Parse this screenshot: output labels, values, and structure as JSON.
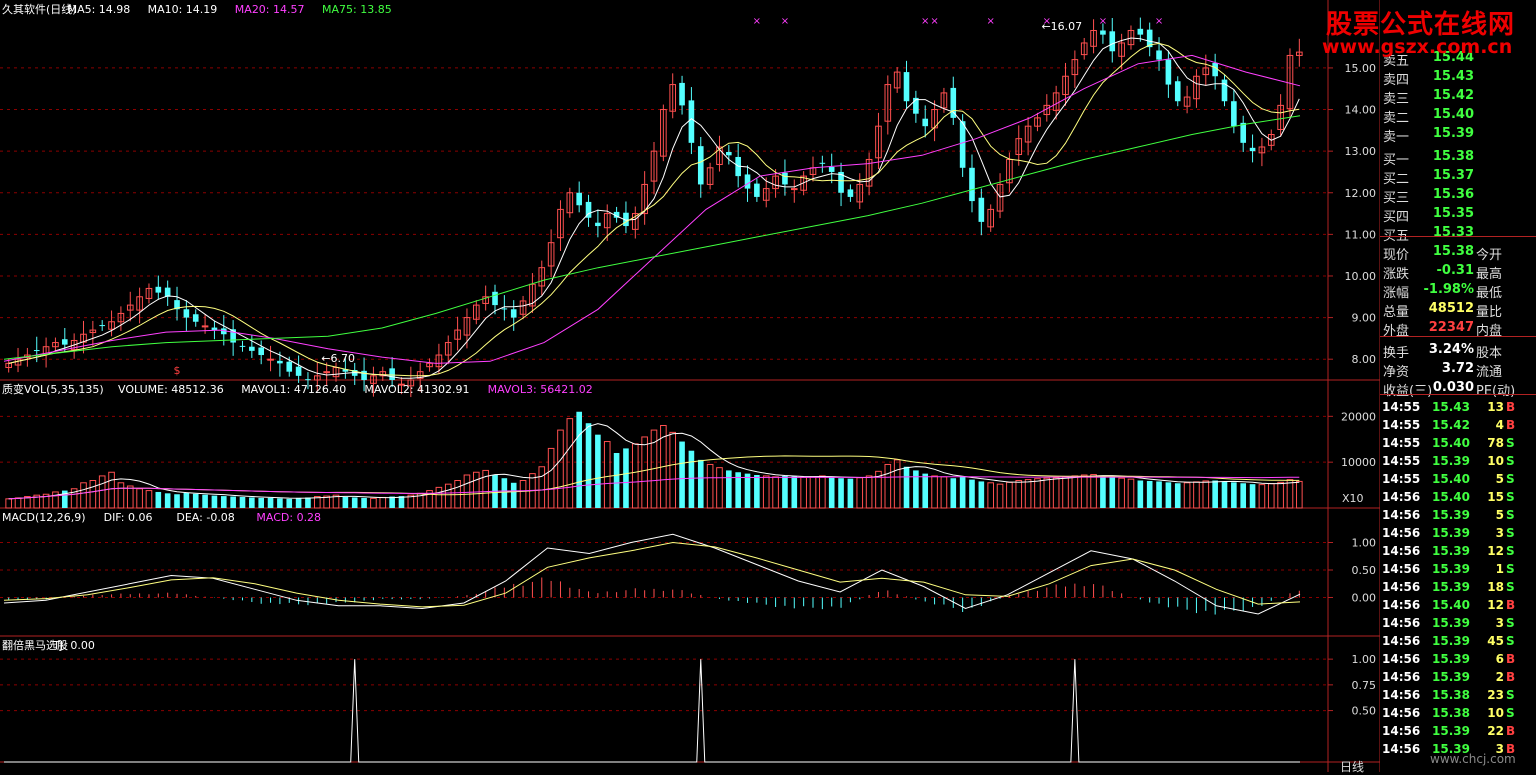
{
  "colors": {
    "up": "#ff5050",
    "down": "#54ffff",
    "ma5": "#ffffff",
    "ma10": "#ffff80",
    "ma20": "#ff40ff",
    "ma75": "#40ff40",
    "grid": "#8b0000",
    "axis": "#b22222"
  },
  "logo": {
    "line1": "股票公式在线网",
    "line2": "www.gszx.com.cn"
  },
  "watermark": "www.chcj.com",
  "bottom_label": "日线",
  "chart_data": [
    {
      "type": "candlestick",
      "panel": "price",
      "legend": [
        {
          "text": "久其软件(日线)",
          "color": "#ffffff"
        },
        {
          "text": "MA5: 14.98",
          "color": "#ffffff"
        },
        {
          "text": "MA10: 14.19",
          "color": "#ffffff"
        },
        {
          "text": "MA20: 14.57",
          "color": "#ff40ff"
        },
        {
          "text": "MA75: 13.85",
          "color": "#40ff40"
        }
      ],
      "ylim": [
        7.5,
        16.2
      ],
      "yticks": [
        "8.00",
        "9.00",
        "10.00",
        "11.00",
        "12.00",
        "13.00",
        "14.00",
        "15.00"
      ],
      "ytick_values": [
        8,
        9,
        10,
        11,
        12,
        13,
        14,
        15
      ],
      "annotations": [
        {
          "text": "16.07",
          "x_index": 110,
          "y": 16.07
        },
        {
          "text": "6.70",
          "x_index": 33,
          "y": 6.7
        },
        {
          "text": "$",
          "x_index": 18,
          "y": 7.2
        }
      ],
      "closes": [
        7.9,
        8.0,
        8.1,
        8.2,
        8.3,
        8.4,
        8.35,
        8.45,
        8.6,
        8.7,
        8.8,
        8.9,
        9.1,
        9.3,
        9.5,
        9.7,
        9.6,
        9.5,
        9.2,
        9.0,
        8.9,
        8.8,
        8.7,
        8.6,
        8.4,
        8.3,
        8.2,
        8.1,
        8.0,
        7.9,
        7.7,
        7.6,
        7.5,
        7.6,
        7.7,
        7.8,
        7.7,
        7.6,
        7.5,
        7.6,
        7.7,
        7.5,
        7.4,
        7.5,
        7.7,
        7.9,
        8.1,
        8.4,
        8.7,
        9.0,
        9.3,
        9.5,
        9.3,
        9.2,
        9.0,
        9.4,
        9.8,
        10.2,
        10.8,
        11.6,
        12.0,
        11.7,
        11.4,
        11.2,
        11.5,
        11.4,
        11.2,
        11.5,
        12.2,
        13.0,
        14.0,
        14.6,
        14.1,
        13.2,
        12.2,
        12.6,
        13.1,
        12.9,
        12.4,
        12.1,
        11.9,
        12.1,
        12.4,
        12.2,
        12.1,
        12.4,
        12.6,
        12.7,
        12.5,
        12.0,
        11.9,
        12.2,
        12.8,
        13.6,
        14.6,
        14.9,
        14.2,
        13.9,
        13.6,
        14.0,
        14.4,
        13.8,
        12.6,
        11.8,
        11.3,
        11.6,
        12.2,
        12.8,
        13.3,
        13.6,
        13.8,
        14.1,
        14.4,
        14.8,
        15.2,
        15.6,
        15.9,
        15.8,
        15.4,
        15.6,
        15.9,
        15.8,
        15.5,
        15.2,
        14.6,
        14.2,
        14.3,
        14.8,
        15.0,
        14.8,
        14.2,
        13.6,
        13.2,
        13.0,
        13.1,
        13.4,
        14.1,
        15.3,
        15.38
      ],
      "ma75_points": [
        8.0,
        8.15,
        8.3,
        8.4,
        8.45,
        8.5,
        8.55,
        8.75,
        9.1,
        9.5,
        9.9,
        10.2,
        10.45,
        10.7,
        10.95,
        11.2,
        11.45,
        11.75,
        12.1,
        12.45,
        12.8,
        13.1,
        13.4,
        13.65,
        13.85
      ],
      "ma20_points": [
        7.95,
        8.2,
        8.45,
        8.65,
        8.7,
        8.5,
        8.25,
        8.05,
        7.9,
        7.95,
        8.4,
        9.2,
        10.4,
        11.6,
        12.4,
        12.6,
        12.7,
        12.9,
        13.3,
        13.8,
        14.5,
        15.1,
        15.3,
        14.9,
        14.57
      ]
    },
    {
      "type": "bar",
      "panel": "volume",
      "legend": [
        {
          "text": "质变VOL(5,35,135)",
          "color": "#ffffff"
        },
        {
          "text": "VOLUME: 48512.36",
          "color": "#ffffff"
        },
        {
          "text": "MAVOL1: 47126.40",
          "color": "#ffffff"
        },
        {
          "text": "MAVOL2: 41302.91",
          "color": "#ffffff"
        },
        {
          "text": "MAVOL3: 56421.02",
          "color": "#ff40ff"
        }
      ],
      "yticks": [
        "20000",
        "10000"
      ],
      "ytick_values": [
        20000,
        10000
      ],
      "ylim": [
        0,
        24000
      ],
      "unit": "X10",
      "values": [
        2000,
        2200,
        2500,
        2800,
        3000,
        3500,
        3800,
        4200,
        5500,
        6000,
        7000,
        7800,
        5500,
        4800,
        4200,
        3800,
        3500,
        3200,
        3000,
        3300,
        3100,
        2900,
        2700,
        2600,
        2500,
        2400,
        2300,
        2200,
        2200,
        2100,
        2000,
        2200,
        2300,
        2500,
        2600,
        2800,
        2400,
        2300,
        2200,
        2100,
        2300,
        2500,
        2600,
        2800,
        3200,
        3800,
        4500,
        5200,
        6000,
        7200,
        7800,
        8200,
        7200,
        6500,
        5500,
        6000,
        7500,
        9000,
        13000,
        17000,
        19500,
        21000,
        18500,
        16000,
        14500,
        12000,
        13000,
        14000,
        15500,
        17000,
        18000,
        16500,
        14500,
        12500,
        10500,
        9500,
        8800,
        8200,
        7800,
        7500,
        7200,
        7000,
        6800,
        7000,
        6900,
        6700,
        6800,
        7000,
        6800,
        6500,
        6400,
        6600,
        7000,
        8000,
        9500,
        10500,
        9000,
        8200,
        7500,
        7000,
        6800,
        6500,
        6800,
        6200,
        5800,
        5500,
        5200,
        5600,
        6000,
        6200,
        6400,
        6500,
        6600,
        6800,
        7000,
        7200,
        7300,
        7100,
        6800,
        6500,
        6300,
        6000,
        5900,
        5800,
        5600,
        5400,
        5500,
        5700,
        5900,
        6000,
        5800,
        5600,
        5400,
        5200,
        5100,
        5300,
        5600,
        6200,
        5800
      ]
    },
    {
      "type": "line",
      "panel": "macd",
      "legend": [
        {
          "text": "MACD(12,26,9)",
          "color": "#ffffff"
        },
        {
          "text": "DIF: 0.06",
          "color": "#ffffff"
        },
        {
          "text": "DEA: -0.08",
          "color": "#ffffff"
        },
        {
          "text": "MACD: 0.28",
          "color": "#ff40ff"
        }
      ],
      "yticks": [
        "1.00",
        "0.50",
        "0.00"
      ],
      "ytick_values": [
        1,
        0.5,
        0
      ],
      "ylim": [
        -0.7,
        1.3
      ],
      "dif_points": [
        -0.1,
        -0.05,
        0.1,
        0.25,
        0.4,
        0.35,
        0.15,
        -0.05,
        -0.15,
        -0.15,
        -0.2,
        -0.1,
        0.3,
        0.9,
        0.8,
        1.0,
        1.15,
        0.9,
        0.6,
        0.3,
        0.1,
        0.5,
        0.2,
        -0.2,
        0.05,
        0.45,
        0.85,
        0.7,
        0.3,
        -0.15,
        -0.3,
        0.06
      ],
      "dea_points": [
        -0.05,
        -0.02,
        0.05,
        0.18,
        0.32,
        0.36,
        0.25,
        0.08,
        -0.05,
        -0.12,
        -0.17,
        -0.14,
        0.08,
        0.55,
        0.72,
        0.85,
        1.0,
        0.92,
        0.72,
        0.5,
        0.28,
        0.35,
        0.28,
        0.05,
        0.02,
        0.25,
        0.58,
        0.7,
        0.5,
        0.15,
        -0.12,
        -0.08
      ],
      "hist": [
        -0.05,
        -0.03,
        0.05,
        0.07,
        0.08,
        -0.01,
        -0.1,
        -0.13,
        -0.1,
        -0.03,
        -0.03,
        0.04,
        0.22,
        0.35,
        0.08,
        0.15,
        0.15,
        -0.02,
        -0.12,
        -0.2,
        -0.18,
        0.15,
        -0.08,
        -0.25,
        0.03,
        0.2,
        0.27,
        0.0,
        -0.2,
        -0.3,
        -0.18,
        0.14
      ]
    },
    {
      "type": "line",
      "panel": "tj",
      "legend": [
        {
          "text": "翻倍黑马选股",
          "color": "#ffffff"
        },
        {
          "text": "TJ: 0.00",
          "color": "#ffffff"
        }
      ],
      "yticks": [
        "1.00",
        "0.75",
        "0.50"
      ],
      "ytick_values": [
        1,
        0.75,
        0.5
      ],
      "ylim": [
        0,
        1.05
      ],
      "signal_indices": [
        37,
        74,
        114
      ]
    }
  ],
  "sidebar": {
    "quotes": [
      {
        "label": "卖五",
        "value": "15.44",
        "color": "#40ff40"
      },
      {
        "label": "卖四",
        "value": "15.43",
        "color": "#40ff40"
      },
      {
        "label": "卖三",
        "value": "15.42",
        "color": "#40ff40"
      },
      {
        "label": "卖二",
        "value": "15.40",
        "color": "#40ff40"
      },
      {
        "label": "卖一",
        "value": "15.39",
        "color": "#40ff40"
      },
      {
        "label": "买一",
        "value": "15.38",
        "color": "#40ff40"
      },
      {
        "label": "买二",
        "value": "15.37",
        "color": "#40ff40"
      },
      {
        "label": "买三",
        "value": "15.36",
        "color": "#40ff40"
      },
      {
        "label": "买四",
        "value": "15.35",
        "color": "#40ff40"
      },
      {
        "label": "买五",
        "value": "15.33",
        "color": "#40ff40"
      }
    ],
    "stats": [
      {
        "label": "现价",
        "value": "15.38",
        "color": "#40ff40",
        "label2": "今开"
      },
      {
        "label": "涨跌",
        "value": "-0.31",
        "color": "#40ff40",
        "label2": "最高"
      },
      {
        "label": "涨幅",
        "value": "-1.98%",
        "color": "#40ff40",
        "label2": "最低"
      },
      {
        "label": "总量",
        "value": "48512",
        "color": "#ffff66",
        "label2": "量比"
      },
      {
        "label": "外盘",
        "value": "22347",
        "color": "#ff4040",
        "label2": "内盘"
      }
    ],
    "extra": [
      {
        "label": "换手",
        "value": "3.24%",
        "color": "#ffffff",
        "label2": "股本"
      },
      {
        "label": "净资",
        "value": "3.72",
        "color": "#ffffff",
        "label2": "流通"
      },
      {
        "label": "收益(三)",
        "value": "0.030",
        "color": "#ffffff",
        "label2": "PE(动)"
      }
    ],
    "ticks": [
      {
        "time": "14:55",
        "price": "15.43",
        "vol": "13",
        "dir": "B"
      },
      {
        "time": "14:55",
        "price": "15.42",
        "vol": "4",
        "dir": "B"
      },
      {
        "time": "14:55",
        "price": "15.40",
        "vol": "78",
        "dir": "S"
      },
      {
        "time": "14:55",
        "price": "15.39",
        "vol": "10",
        "dir": "S"
      },
      {
        "time": "14:55",
        "price": "15.40",
        "vol": "5",
        "dir": "S"
      },
      {
        "time": "14:56",
        "price": "15.40",
        "vol": "15",
        "dir": "S"
      },
      {
        "time": "14:56",
        "price": "15.39",
        "vol": "5",
        "dir": "S"
      },
      {
        "time": "14:56",
        "price": "15.39",
        "vol": "3",
        "dir": "S"
      },
      {
        "time": "14:56",
        "price": "15.39",
        "vol": "12",
        "dir": "S"
      },
      {
        "time": "14:56",
        "price": "15.39",
        "vol": "1",
        "dir": "S"
      },
      {
        "time": "14:56",
        "price": "15.39",
        "vol": "18",
        "dir": "S"
      },
      {
        "time": "14:56",
        "price": "15.40",
        "vol": "12",
        "dir": "B"
      },
      {
        "time": "14:56",
        "price": "15.39",
        "vol": "3",
        "dir": "S"
      },
      {
        "time": "14:56",
        "price": "15.39",
        "vol": "45",
        "dir": "S"
      },
      {
        "time": "14:56",
        "price": "15.39",
        "vol": "6",
        "dir": "B"
      },
      {
        "time": "14:56",
        "price": "15.39",
        "vol": "2",
        "dir": "B"
      },
      {
        "time": "14:56",
        "price": "15.38",
        "vol": "23",
        "dir": "S"
      },
      {
        "time": "14:56",
        "price": "15.38",
        "vol": "10",
        "dir": "S"
      },
      {
        "time": "14:56",
        "price": "15.39",
        "vol": "22",
        "dir": "B"
      },
      {
        "time": "14:56",
        "price": "15.39",
        "vol": "3",
        "dir": "B"
      }
    ]
  }
}
